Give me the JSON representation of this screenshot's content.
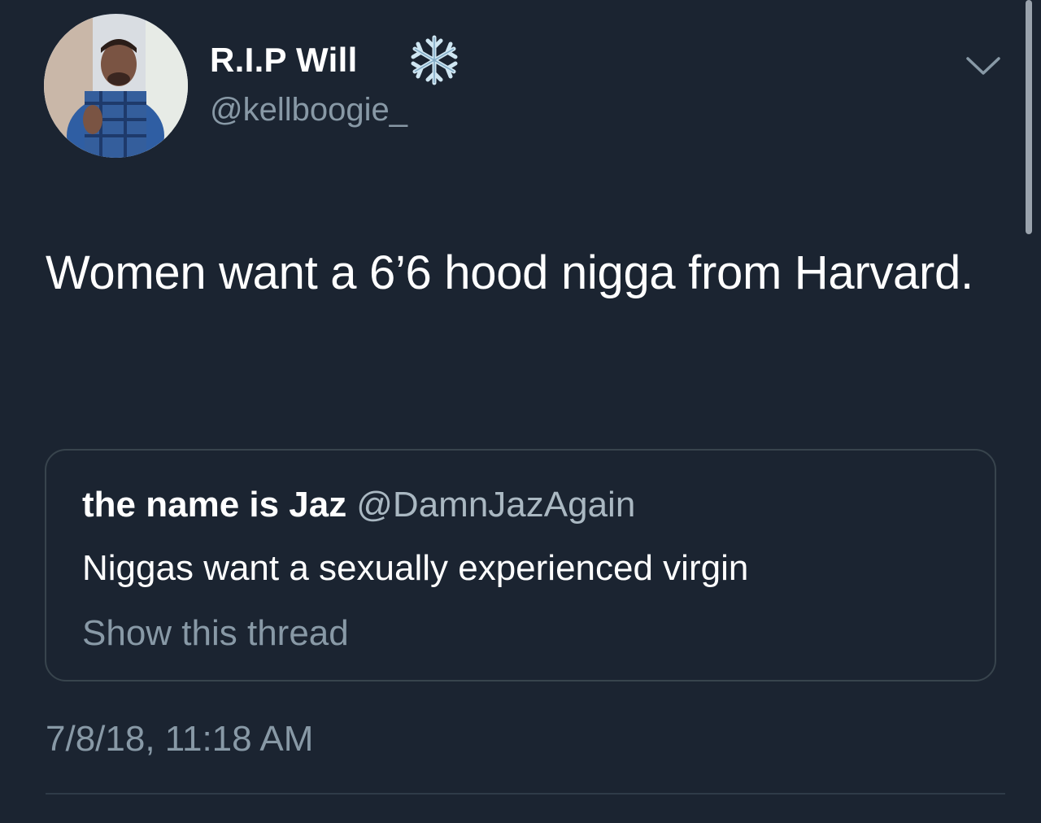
{
  "tweet": {
    "display_name": "R.I.P Will",
    "handle": "@kellboogie_",
    "text": "Women want a 6’6 hood nigga from Harvard.",
    "timestamp": "7/8/18, 11:18 AM",
    "name_emoji_icon": "snowflake-icon",
    "menu_icon": "chevron-down-icon"
  },
  "quoted_tweet": {
    "display_name": "the name is Jaz",
    "handle": "@DamnJazAgain",
    "text": "Niggas want a sexually experienced virgin",
    "show_thread_label": "Show this thread"
  },
  "colors": {
    "background": "#1b2431",
    "primary_text": "#ffffff",
    "secondary_text": "#8899a6",
    "border": "#38444d"
  }
}
